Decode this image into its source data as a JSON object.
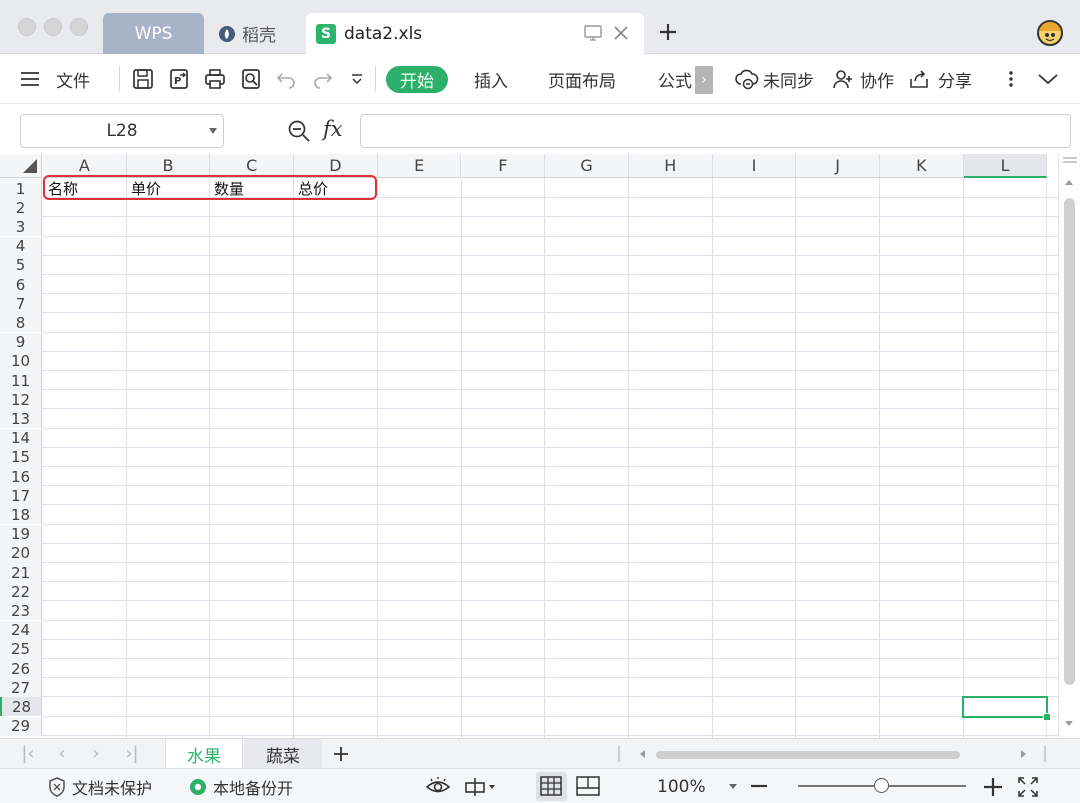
{
  "titlebar": {
    "tabs": [
      {
        "label": "WPS"
      },
      {
        "label": "稻壳"
      },
      {
        "label": "data2.xls"
      }
    ]
  },
  "toolbar": {
    "file_label": "文件",
    "ribbon_tabs": [
      "开始",
      "插入",
      "页面布局",
      "公式"
    ],
    "sync_label": "未同步",
    "collab_label": "协作",
    "share_label": "分享"
  },
  "formula_bar": {
    "name_box": "L28",
    "fx_label": "fx",
    "formula_value": ""
  },
  "sheet": {
    "columns": [
      "A",
      "B",
      "C",
      "D",
      "E",
      "F",
      "G",
      "H",
      "I",
      "J",
      "K",
      "L"
    ],
    "rows": [
      "1",
      "2",
      "3",
      "4",
      "5",
      "6",
      "7",
      "8",
      "9",
      "10",
      "11",
      "12",
      "13",
      "14",
      "15",
      "16",
      "17",
      "18",
      "19",
      "20",
      "21",
      "22",
      "23",
      "24",
      "25",
      "26",
      "27",
      "28",
      "29"
    ],
    "row1_cells": [
      "名称",
      "单价",
      "数量",
      "总价"
    ],
    "selected_cell": "L28",
    "highlight_color": "#e0303a",
    "accent_color": "#2bb06a"
  },
  "sheet_tabs": {
    "tabs": [
      "水果",
      "蔬菜"
    ],
    "active": "水果"
  },
  "statusbar": {
    "protect_label": "文档未保护",
    "backup_label": "本地备份开",
    "zoom_label": "100%",
    "zoom_level": 0.5
  }
}
